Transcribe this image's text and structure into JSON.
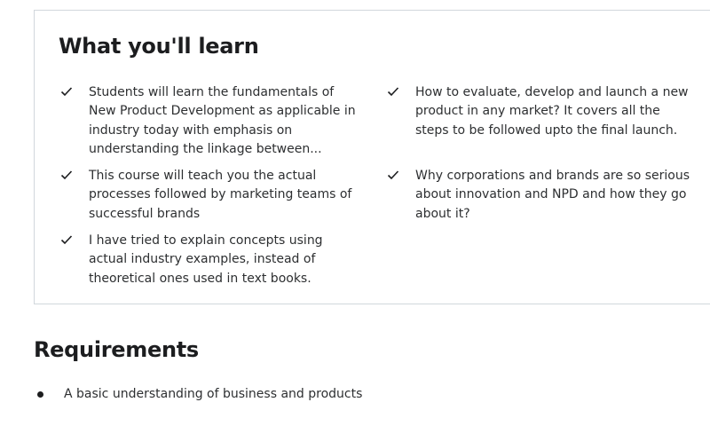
{
  "learn": {
    "title": "What you'll learn",
    "items": [
      {
        "text": "Students will learn the fundamentals of New Product Development as applicable in industry today with emphasis on understanding the linkage between..."
      },
      {
        "text": "How to evaluate, develop and launch a new product in any market? It covers all the steps to be followed upto the final launch."
      },
      {
        "text": "This course will teach you the actual processes followed by marketing teams of successful brands"
      },
      {
        "text": "Why corporations and brands are so serious about innovation and NPD and how they go about it?"
      },
      {
        "text": "I have tried to explain concepts using actual industry examples, instead of theoretical ones used in text books."
      }
    ],
    "icon": "check-icon"
  },
  "requirements": {
    "title": "Requirements",
    "items": [
      {
        "text": "A basic understanding of business and products"
      }
    ],
    "icon": "bullet-icon"
  }
}
